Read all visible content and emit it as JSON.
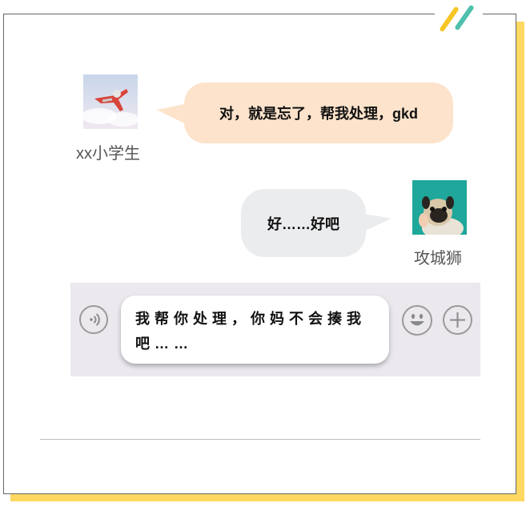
{
  "chat": {
    "messages": [
      {
        "sender": "xx小学生",
        "text": "对，就是忘了，帮我处理，gkd",
        "side": "left",
        "bubble_color": "#fde3cb"
      },
      {
        "sender": "攻城狮",
        "text": "好……好吧",
        "side": "right",
        "bubble_color": "#ebecee"
      }
    ]
  },
  "composer": {
    "draft_text": "我帮你处理，你妈不会揍我吧……",
    "background_color": "#ebe8ee"
  },
  "icons": {
    "voice": "voice-icon",
    "emoji": "emoji-icon",
    "add": "plus-icon"
  },
  "theme": {
    "accent_yellow": "#fed861",
    "accent_teal": "#4fc0ad"
  }
}
